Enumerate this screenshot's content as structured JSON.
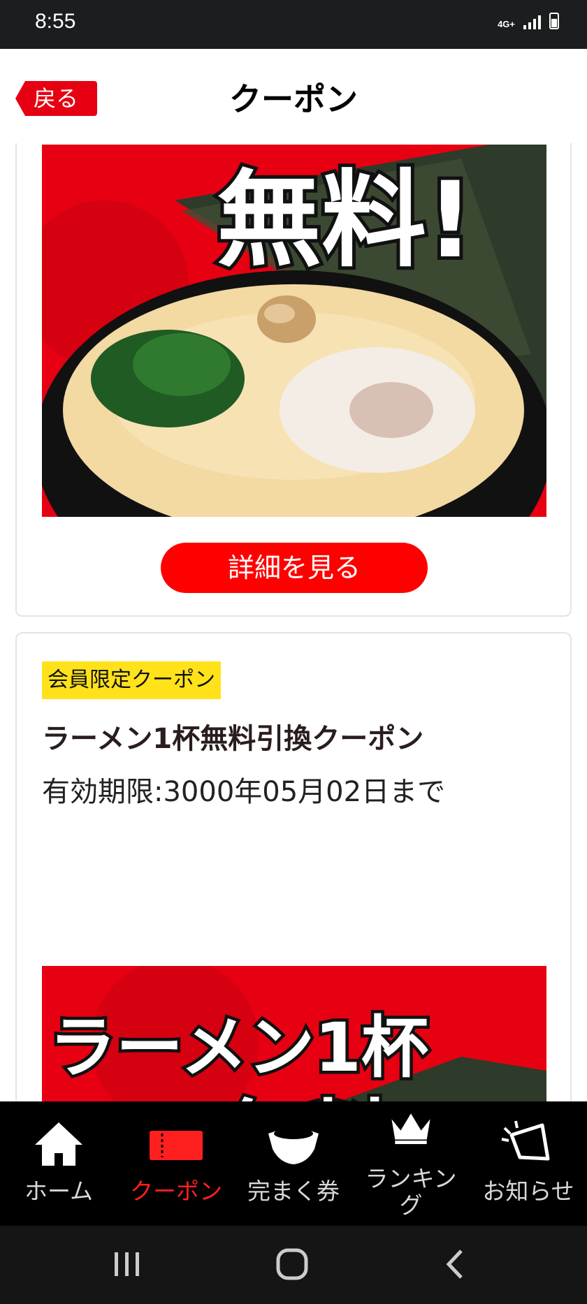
{
  "status": {
    "time": "8:55",
    "network": "4G+"
  },
  "header": {
    "back_label": "戻る",
    "title": "クーポン"
  },
  "coupon1": {
    "details_button": "詳細を見る"
  },
  "coupon2": {
    "badge": "会員限定クーポン",
    "title": "ラーメン1杯無料引換クーポン",
    "expiry": "有効期限:3000年05月02日まで"
  },
  "banner_text": {
    "line1": "ラーメン1杯",
    "line2": "無料!"
  },
  "nav": [
    {
      "label": "ホーム",
      "icon": "home-icon"
    },
    {
      "label": "クーポン",
      "icon": "ticket-icon"
    },
    {
      "label": "完まく券",
      "icon": "bowl-icon"
    },
    {
      "label": "ランキング",
      "icon": "crown-icon"
    },
    {
      "label": "お知らせ",
      "icon": "megaphone-icon"
    }
  ],
  "colors": {
    "brand_red": "#e60012",
    "badge_yellow": "#ffe21a",
    "active_nav": "#ff1f1f"
  }
}
